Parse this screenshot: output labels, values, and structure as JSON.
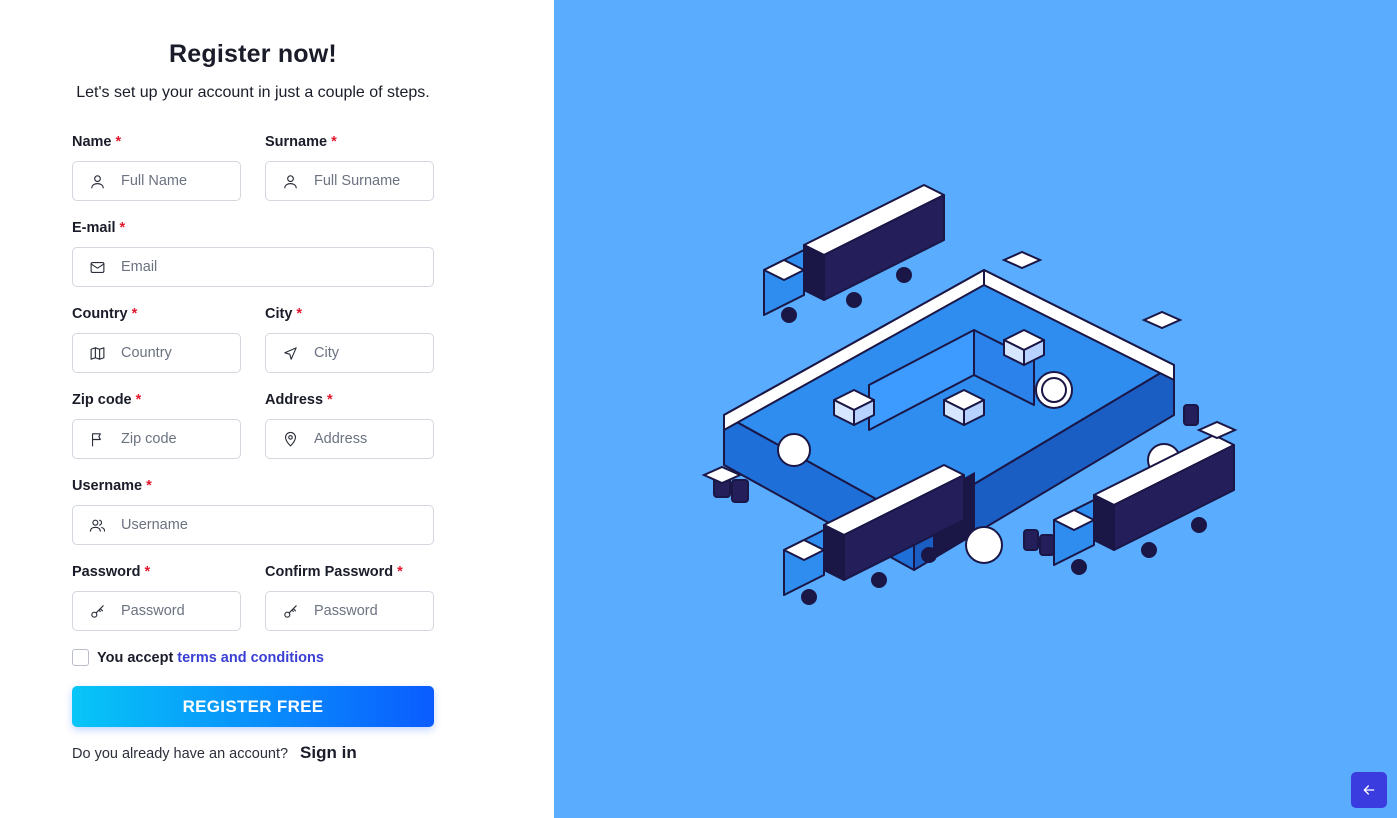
{
  "header": {
    "title": "Register now!",
    "subtitle": "Let's set up your account in just a couple of steps."
  },
  "form": {
    "required_mark": "*",
    "name": {
      "label": "Name",
      "placeholder": "Full Name",
      "icon": "user-icon"
    },
    "surname": {
      "label": "Surname",
      "placeholder": "Full Surname",
      "icon": "user-icon"
    },
    "email": {
      "label": "E-mail",
      "placeholder": "Email",
      "icon": "mail-icon"
    },
    "country": {
      "label": "Country",
      "placeholder": "Country",
      "icon": "map-icon"
    },
    "city": {
      "label": "City",
      "placeholder": "City",
      "icon": "navigation-icon"
    },
    "zip": {
      "label": "Zip code",
      "placeholder": "Zip code",
      "icon": "flag-icon"
    },
    "address": {
      "label": "Address",
      "placeholder": "Address",
      "icon": "map-pin-icon"
    },
    "username": {
      "label": "Username",
      "placeholder": "Username",
      "icon": "users-icon"
    },
    "password": {
      "label": "Password",
      "placeholder": "Password",
      "icon": "key-icon"
    },
    "confirm_password": {
      "label": "Confirm Password",
      "placeholder": "Password",
      "icon": "key-icon"
    },
    "terms": {
      "prefix": "You accept",
      "link": "terms and conditions",
      "checked": false
    },
    "submit_label": "REGISTER FREE",
    "signin_question": "Do you already have an account?",
    "signin_link": "Sign in"
  },
  "illustration": {
    "icon": "warehouse-trucks-illustration"
  },
  "back_button": {
    "icon": "arrow-left-icon"
  },
  "colors": {
    "panel_bg": "#5aacfe",
    "accent": "#3b3ce0",
    "button_gradient_start": "#08c6f7",
    "button_gradient_end": "#0a5cff",
    "required": "#e0182d"
  }
}
